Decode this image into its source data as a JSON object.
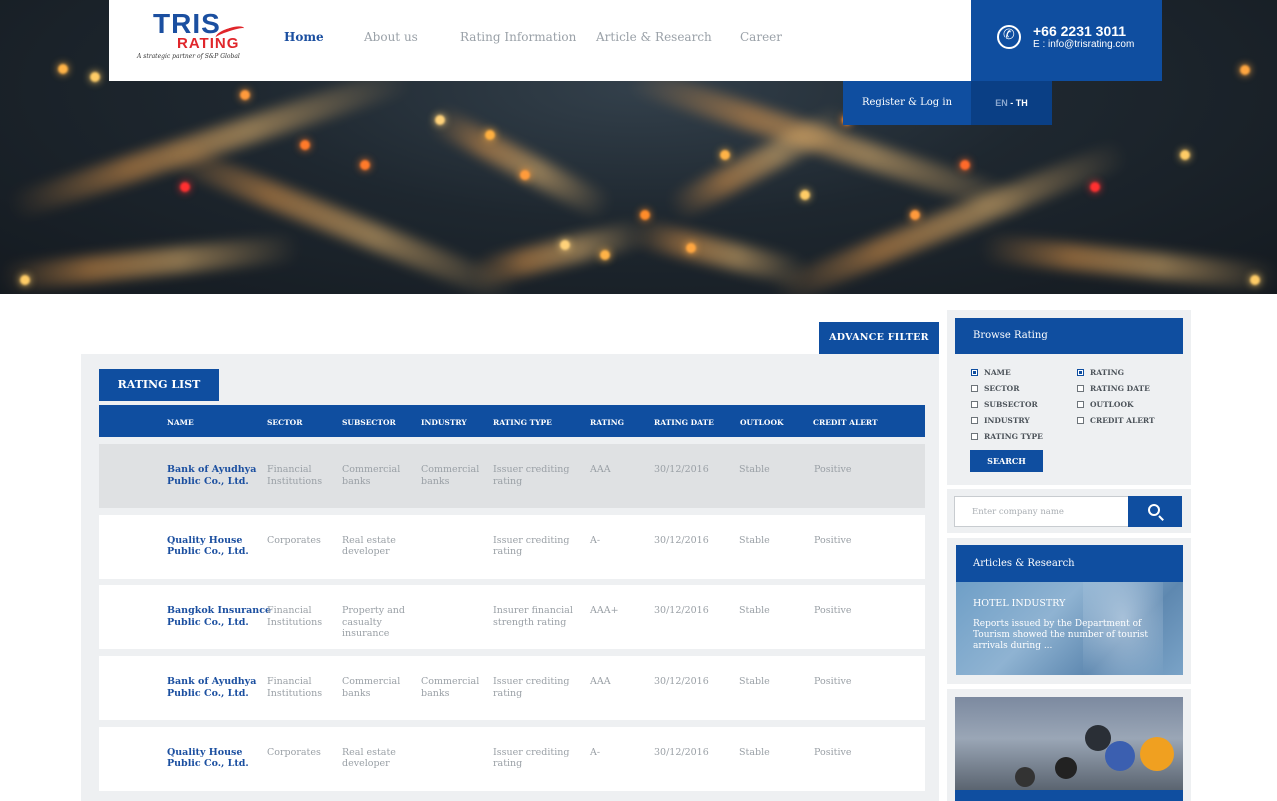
{
  "header": {
    "logo_text_1": "TRIS",
    "logo_text_2": "RATING",
    "logo_tagline": "A strategic partner of S&P Global",
    "nav": [
      "Home",
      "About us",
      "Rating Information",
      "Article & Research",
      "Career"
    ],
    "active_nav": "Home",
    "phone": "+66 2231 3011",
    "email": "E : info@trisrating.com",
    "login_label": "Register & Log in",
    "lang_en": "EN",
    "lang_sep": " - ",
    "lang_th": "TH"
  },
  "main": {
    "advance_filter_label": "ADVANCE FILTER",
    "tab_label": "RATING LIST",
    "columns": [
      "NAME",
      "SECTOR",
      "SUBSECTOR",
      "INDUSTRY",
      "RATING TYPE",
      "RATING",
      "RATING DATE",
      "OUTLOOK",
      "CREDIT ALERT"
    ],
    "rows": [
      {
        "name": [
          "Bank of Ayudhya",
          "Public Co., Ltd."
        ],
        "sector": [
          "Financial",
          "Institutions"
        ],
        "subsector": [
          "Commercial",
          "banks"
        ],
        "industry": [
          "Commercial",
          "banks"
        ],
        "rating_type": [
          "Issuer crediting",
          "rating"
        ],
        "rating": "AAA",
        "date": "30/12/2016",
        "outlook": "Stable",
        "alert": "Positive",
        "highlighted": true
      },
      {
        "name": [
          "Quality House",
          "Public Co., Ltd."
        ],
        "sector": [
          "Corporates"
        ],
        "subsector": [
          "Real estate",
          "developer"
        ],
        "industry": [],
        "rating_type": [
          "Issuer crediting",
          "rating"
        ],
        "rating": "A-",
        "date": "30/12/2016",
        "outlook": "Stable",
        "alert": "Positive",
        "highlighted": false
      },
      {
        "name": [
          "Bangkok Insurance",
          "Public Co., Ltd."
        ],
        "sector": [
          "Financial",
          "Institutions"
        ],
        "subsector": [
          "Property and",
          "casualty",
          "insurance"
        ],
        "industry": [],
        "rating_type": [
          "Insurer financial",
          "strength rating"
        ],
        "rating": "AAA+",
        "date": "30/12/2016",
        "outlook": "Stable",
        "alert": "Positive",
        "highlighted": false
      },
      {
        "name": [
          "Bank of Ayudhya",
          "Public Co., Ltd."
        ],
        "sector": [
          "Financial",
          "Institutions"
        ],
        "subsector": [
          "Commercial",
          "banks"
        ],
        "industry": [
          "Commercial",
          "banks"
        ],
        "rating_type": [
          "Issuer crediting",
          "rating"
        ],
        "rating": "AAA",
        "date": "30/12/2016",
        "outlook": "Stable",
        "alert": "Positive",
        "highlighted": false
      },
      {
        "name": [
          "Quality House",
          "Public Co., Ltd."
        ],
        "sector": [
          "Corporates"
        ],
        "subsector": [
          "Real estate",
          "developer"
        ],
        "industry": [],
        "rating_type": [
          "Issuer crediting",
          "rating"
        ],
        "rating": "A-",
        "date": "30/12/2016",
        "outlook": "Stable",
        "alert": "Positive",
        "highlighted": false
      }
    ]
  },
  "sidebar": {
    "browse_title": "Browse Rating",
    "checkboxes_left": [
      {
        "label": "NAME",
        "checked": true
      },
      {
        "label": "SECTOR",
        "checked": false
      },
      {
        "label": "SUBSECTOR",
        "checked": false
      },
      {
        "label": "INDUSTRY",
        "checked": false
      },
      {
        "label": "RATING TYPE",
        "checked": false
      }
    ],
    "checkboxes_right": [
      {
        "label": "RATING",
        "checked": true
      },
      {
        "label": "RATING DATE",
        "checked": false
      },
      {
        "label": "OUTLOOK",
        "checked": false
      },
      {
        "label": "CREDIT ALERT",
        "checked": false
      }
    ],
    "search_label": "SEARCH",
    "company_placeholder": "Enter company name",
    "articles_title": "Articles & Research",
    "article_heading": "HOTEL INDUSTRY",
    "article_text": "Reports issued by the Department of Tourism showed the number of tourist arrivals during ..."
  },
  "colors": {
    "brand_blue": "#0f4ea0",
    "brand_red": "#e0262b",
    "panel_gray": "#eef0f2"
  }
}
